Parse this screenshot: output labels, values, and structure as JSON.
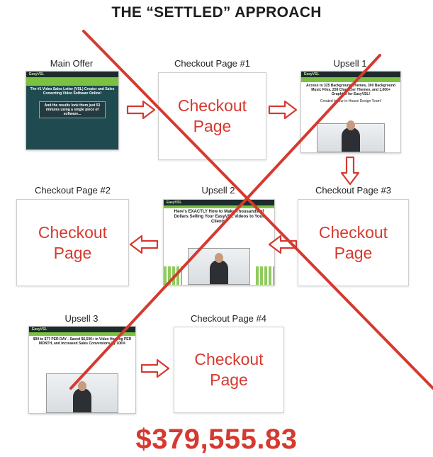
{
  "title": "THE “SETTLED” APPROACH",
  "price": "$379,555.83",
  "colors": {
    "accent_red": "#d6392f",
    "funnel_green": "#7cc242",
    "funnel_dark": "#1d2b2f"
  },
  "labels": {
    "main_offer": "Main Offer",
    "checkout1": "Checkout Page #1",
    "upsell1": "Upsell 1",
    "checkout2": "Checkout Page #2",
    "upsell2": "Upsell 2",
    "checkout3": "Checkout Page #3",
    "upsell3": "Upsell 3",
    "checkout4": "Checkout Page #4"
  },
  "checkout_box": {
    "line1": "Checkout",
    "line2": "Page"
  },
  "thumbnails": {
    "brand": "EasyVSL",
    "main_offer": {
      "headline": "The #1 Video Sales Letter (VSL) Creator and Sales Converting Video Software Online!",
      "subline": "And the results look them just 53 minutes using a single piece of software..."
    },
    "upsell1": {
      "headline": "Access to 325 Background Themes, 300 Background Music Files, 250 Character Themes, and 1,000+ Graphics for EasyVSL!",
      "subline": "Created by our in-House Design Team!"
    },
    "upsell2": {
      "headline": "Here's EXACTLY How to Make Thousands of Dollars Selling Your EasyVSL Videos to Your Clients!"
    },
    "upsell3": {
      "headline": "$90 to $77 PER DAY - Saved $6,500+ in Video Hosting PER MONTH, and Increased Sales Conversions by 106%"
    }
  }
}
